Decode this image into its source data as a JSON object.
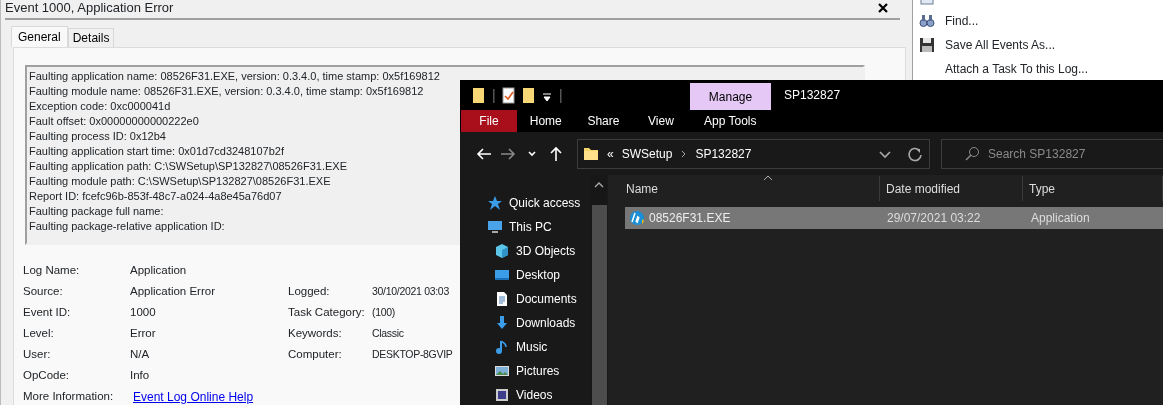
{
  "event_dialog": {
    "title": "Event 1000, Application Error",
    "tabs": [
      {
        "label": "General",
        "selected": true
      },
      {
        "label": "Details",
        "selected": false
      }
    ],
    "description_lines": [
      "Faulting application name: 08526F31.EXE, version: 0.3.4.0, time stamp: 0x5f169812",
      "Faulting module name: 08526F31.EXE, version: 0.3.4.0, time stamp: 0x5f169812",
      "Exception code: 0xc000041d",
      "Fault offset: 0x00000000000222e0",
      "Faulting process ID: 0x12b4",
      "Faulting application start time: 0x01d7cd3248107b2f",
      "Faulting application path: C:\\SWSetup\\SP132827\\08526F31.EXE",
      "Faulting module path: C:\\SWSetup\\SP132827\\08526F31.EXE",
      "Report ID: fcefc96b-853f-48c7-a024-4a8e45a76d07",
      "Faulting package full name:",
      "Faulting package-relative application ID:"
    ],
    "fields": [
      {
        "label": "Log Name:",
        "value": "Application"
      },
      {
        "label": "Source:",
        "value": "Application Error"
      },
      {
        "label": "Event ID:",
        "value": "1000"
      },
      {
        "label": "Level:",
        "value": "Error"
      },
      {
        "label": "User:",
        "value": "N/A"
      },
      {
        "label": "OpCode:",
        "value": "Info"
      }
    ],
    "fields_right": [
      {
        "label": "Logged:",
        "value": "30/10/2021 03:03"
      },
      {
        "label": "Task Category:",
        "value": "(100)"
      },
      {
        "label": "Keywords:",
        "value": "Classic"
      },
      {
        "label": "Computer:",
        "value": "DESKTOP-8GVIP"
      }
    ],
    "more_information": {
      "label": "More Information:",
      "link": "Event Log Online Help"
    }
  },
  "actions_pane": {
    "items": [
      {
        "kind": "properties"
      },
      {
        "label": "Find...",
        "kind": "find"
      },
      {
        "label": "Save All Events As...",
        "kind": "save"
      },
      {
        "label": "Attach a Task To this Log...",
        "kind": "plain"
      }
    ]
  },
  "explorer": {
    "contextual_group": "Manage",
    "title": "SP132827",
    "ribbon_tabs": [
      {
        "label": "File",
        "kind": "file"
      },
      {
        "label": "Home",
        "kind": "tab"
      },
      {
        "label": "Share",
        "kind": "tab"
      },
      {
        "label": "View",
        "kind": "tab"
      },
      {
        "label": "App Tools",
        "kind": "contextual"
      }
    ],
    "address": {
      "overflow": "«",
      "crumbs": [
        "SWSetup",
        "SP132827"
      ]
    },
    "search": {
      "placeholder": "Search SP132827"
    },
    "nav": [
      {
        "label": "Quick access",
        "kind": "star"
      },
      {
        "label": "This PC",
        "kind": "pc",
        "children": [
          {
            "label": "3D Objects",
            "kind": "cube"
          },
          {
            "label": "Desktop",
            "kind": "desktop"
          },
          {
            "label": "Documents",
            "kind": "documents"
          },
          {
            "label": "Downloads",
            "kind": "downloads"
          },
          {
            "label": "Music",
            "kind": "music"
          },
          {
            "label": "Pictures",
            "kind": "pictures"
          },
          {
            "label": "Videos",
            "kind": "videos"
          }
        ]
      }
    ],
    "columns": [
      "Name",
      "Date modified",
      "Type"
    ],
    "files": [
      {
        "name": "08526F31.EXE",
        "date": "29/07/2021 03:22",
        "type": "Application",
        "selected": true
      }
    ]
  }
}
